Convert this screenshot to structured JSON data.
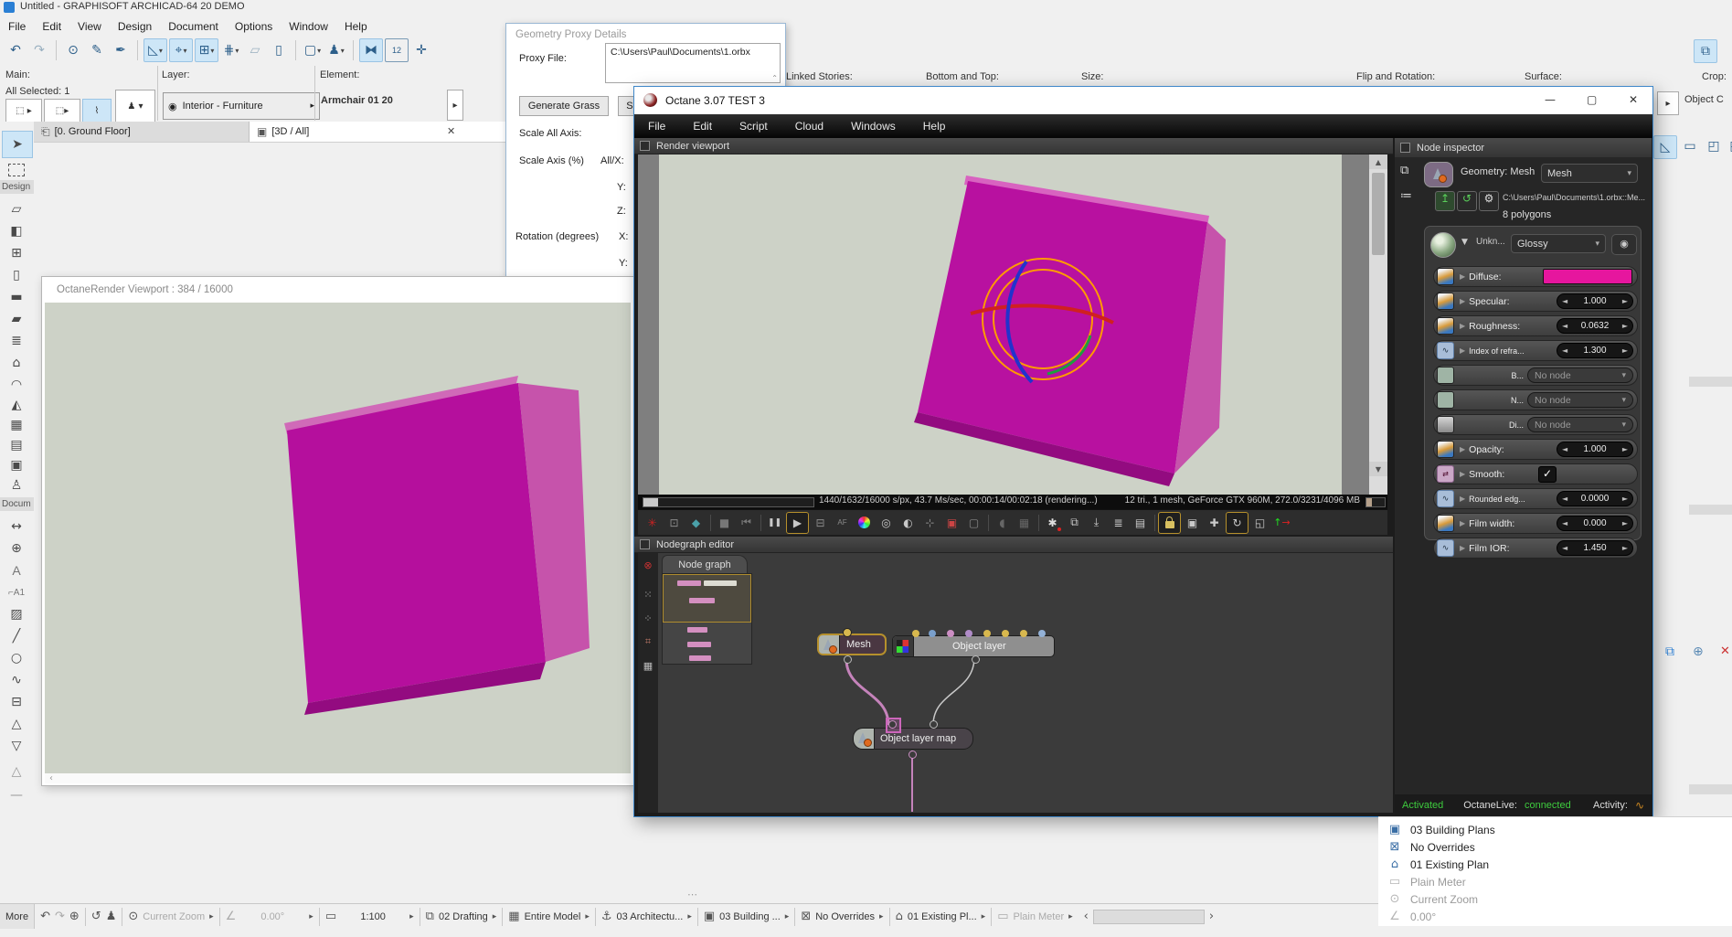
{
  "glyphs": {
    "close": "✕",
    "caret_down": "▾",
    "caret_right": "▸",
    "row_arrow": "▶",
    "spin_l": "◄",
    "spin_r": "►",
    "check": "✓",
    "play": "▶",
    "pause": "❚❚",
    "stop": "■",
    "rew": "⏮",
    "minimize": "—",
    "maximize": "▢",
    "up": "▲",
    "down": "▼",
    "chev_l": "‹",
    "chev_r": "›",
    "dots": "⋯",
    "orbit": "↻",
    "move": "✚",
    "expand": "◱",
    "cube": "▣",
    "af": "AF",
    "eye": "◉",
    "scroll_up": "⌃"
  },
  "archicad": {
    "title": "Untitled - GRAPHISOFT ARCHICAD-64 20 DEMO",
    "menus": [
      "File",
      "Edit",
      "View",
      "Design",
      "Document",
      "Options",
      "Window",
      "Help"
    ],
    "infobar": {
      "main": "Main:",
      "all_selected": "All Selected: 1",
      "layer": "Layer:",
      "layer_value": "Interior - Furniture",
      "element": "Element:",
      "element_value": "Armchair 01 20"
    },
    "prop_labels": {
      "linked_stories": "Linked Stories:",
      "bottom_top": "Bottom and Top:",
      "size": "Size:",
      "flip_rotation": "Flip and Rotation:",
      "surface": "Surface:",
      "crop": "Crop:",
      "crop_value": "Object C"
    },
    "tabs": {
      "ground_floor": "[0. Ground Floor]",
      "three_d": "[3D / All]"
    },
    "toolbox": {
      "design": "Design",
      "document": "Docum"
    },
    "bottombar": {
      "more": "More",
      "current_zoom": "Current Zoom",
      "angle": "0.00°",
      "scale": "1:100",
      "layer_combo": "02 Drafting",
      "model": "Entire Model",
      "arch_set": "03 Architectu...",
      "building": "03 Building ...",
      "overrides": "No Overrides",
      "existing": "01 Existing Pl...",
      "pen": "Plain Meter"
    },
    "quick_options": [
      {
        "label": "03 Building Plans"
      },
      {
        "label": "No Overrides"
      },
      {
        "label": "01 Existing Plan"
      },
      {
        "label": "Plain Meter"
      },
      {
        "label": "Current Zoom"
      },
      {
        "label": "0.00°"
      }
    ]
  },
  "proxy_dialog": {
    "title": "Geometry Proxy Details",
    "proxy_file": "Proxy File:",
    "proxy_path": "C:\\Users\\Paul\\Documents\\1.orbx",
    "generate_grass": "Generate Grass",
    "se_button": "Se",
    "scale_all": "Scale All Axis:",
    "scale_axis": "Scale Axis (%)",
    "all_x": "All/X:",
    "y": "Y:",
    "z": "Z:",
    "rotation": "Rotation (degrees)",
    "rot_x": "X:",
    "rot_y": "Y:"
  },
  "ocr_window": {
    "title": "OctaneRender Viewport : 384  / 16000"
  },
  "octane": {
    "title": "Octane 3.07 TEST 3",
    "menus": [
      "File",
      "Edit",
      "Script",
      "Cloud",
      "Windows",
      "Help"
    ],
    "render_header": "Render viewport",
    "status_left": "1440/1632/16000 s/px, 43.7 Ms/sec, 00:00:14/00:02:18 (rendering...)",
    "status_right": "12 tri., 1 mesh, GeForce GTX 960M, 272.0/3231/4096 MB",
    "nodegraph_header": "Nodegraph editor",
    "node_tab": "Node graph",
    "nodes": {
      "mesh": "Mesh",
      "object_layer": "Object layer",
      "object_layer_map": "Object layer map"
    },
    "inspector": {
      "header": "Node inspector",
      "geometry_label": "Geometry: Mesh",
      "geometry_value": "Mesh",
      "mesh_path": "C:\\Users\\Paul\\Documents\\1.orbx::Me...",
      "polygons": "8 polygons",
      "material_label": "Unkn...",
      "material_value": "Glossy",
      "params": [
        {
          "label": "Diffuse:",
          "value": "",
          "type": "color"
        },
        {
          "label": "Specular:",
          "value": "1.000",
          "type": "spin"
        },
        {
          "label": "Roughness:",
          "value": "0.0632",
          "type": "spin"
        },
        {
          "label": "Index of refra...",
          "value": "1.300",
          "type": "spin"
        },
        {
          "label": "B...",
          "value": "No node",
          "type": "node"
        },
        {
          "label": "N...",
          "value": "No node",
          "type": "node"
        },
        {
          "label": "Di...",
          "value": "No node",
          "type": "node"
        },
        {
          "label": "Opacity:",
          "value": "1.000",
          "type": "spin"
        },
        {
          "label": "Smooth:",
          "value": "✓",
          "type": "check"
        },
        {
          "label": "Rounded edg...",
          "value": "0.0000",
          "type": "spin"
        },
        {
          "label": "Film width:",
          "value": "0.000",
          "type": "spin"
        },
        {
          "label": "Film IOR:",
          "value": "1.450",
          "type": "spin"
        }
      ]
    },
    "footer": {
      "activated": "Activated",
      "live_label": "OctaneLive:",
      "live_value": "connected",
      "activity": "Activity:"
    }
  },
  "colors": {
    "magenta_front": "#b50f9d",
    "magenta_side": "#c653ab",
    "magenta_dark": "#930b80",
    "magenta_top": "#d863c0",
    "render_bg": "#cdd2c7",
    "gold": "#b6902c",
    "wire_pink": "#c583bb",
    "wire_grey": "#c9c9c9",
    "status_green": "#3ecc3e",
    "diffuse_swatch": "#e6169e",
    "gizmo_orange": "#ff9a00"
  }
}
